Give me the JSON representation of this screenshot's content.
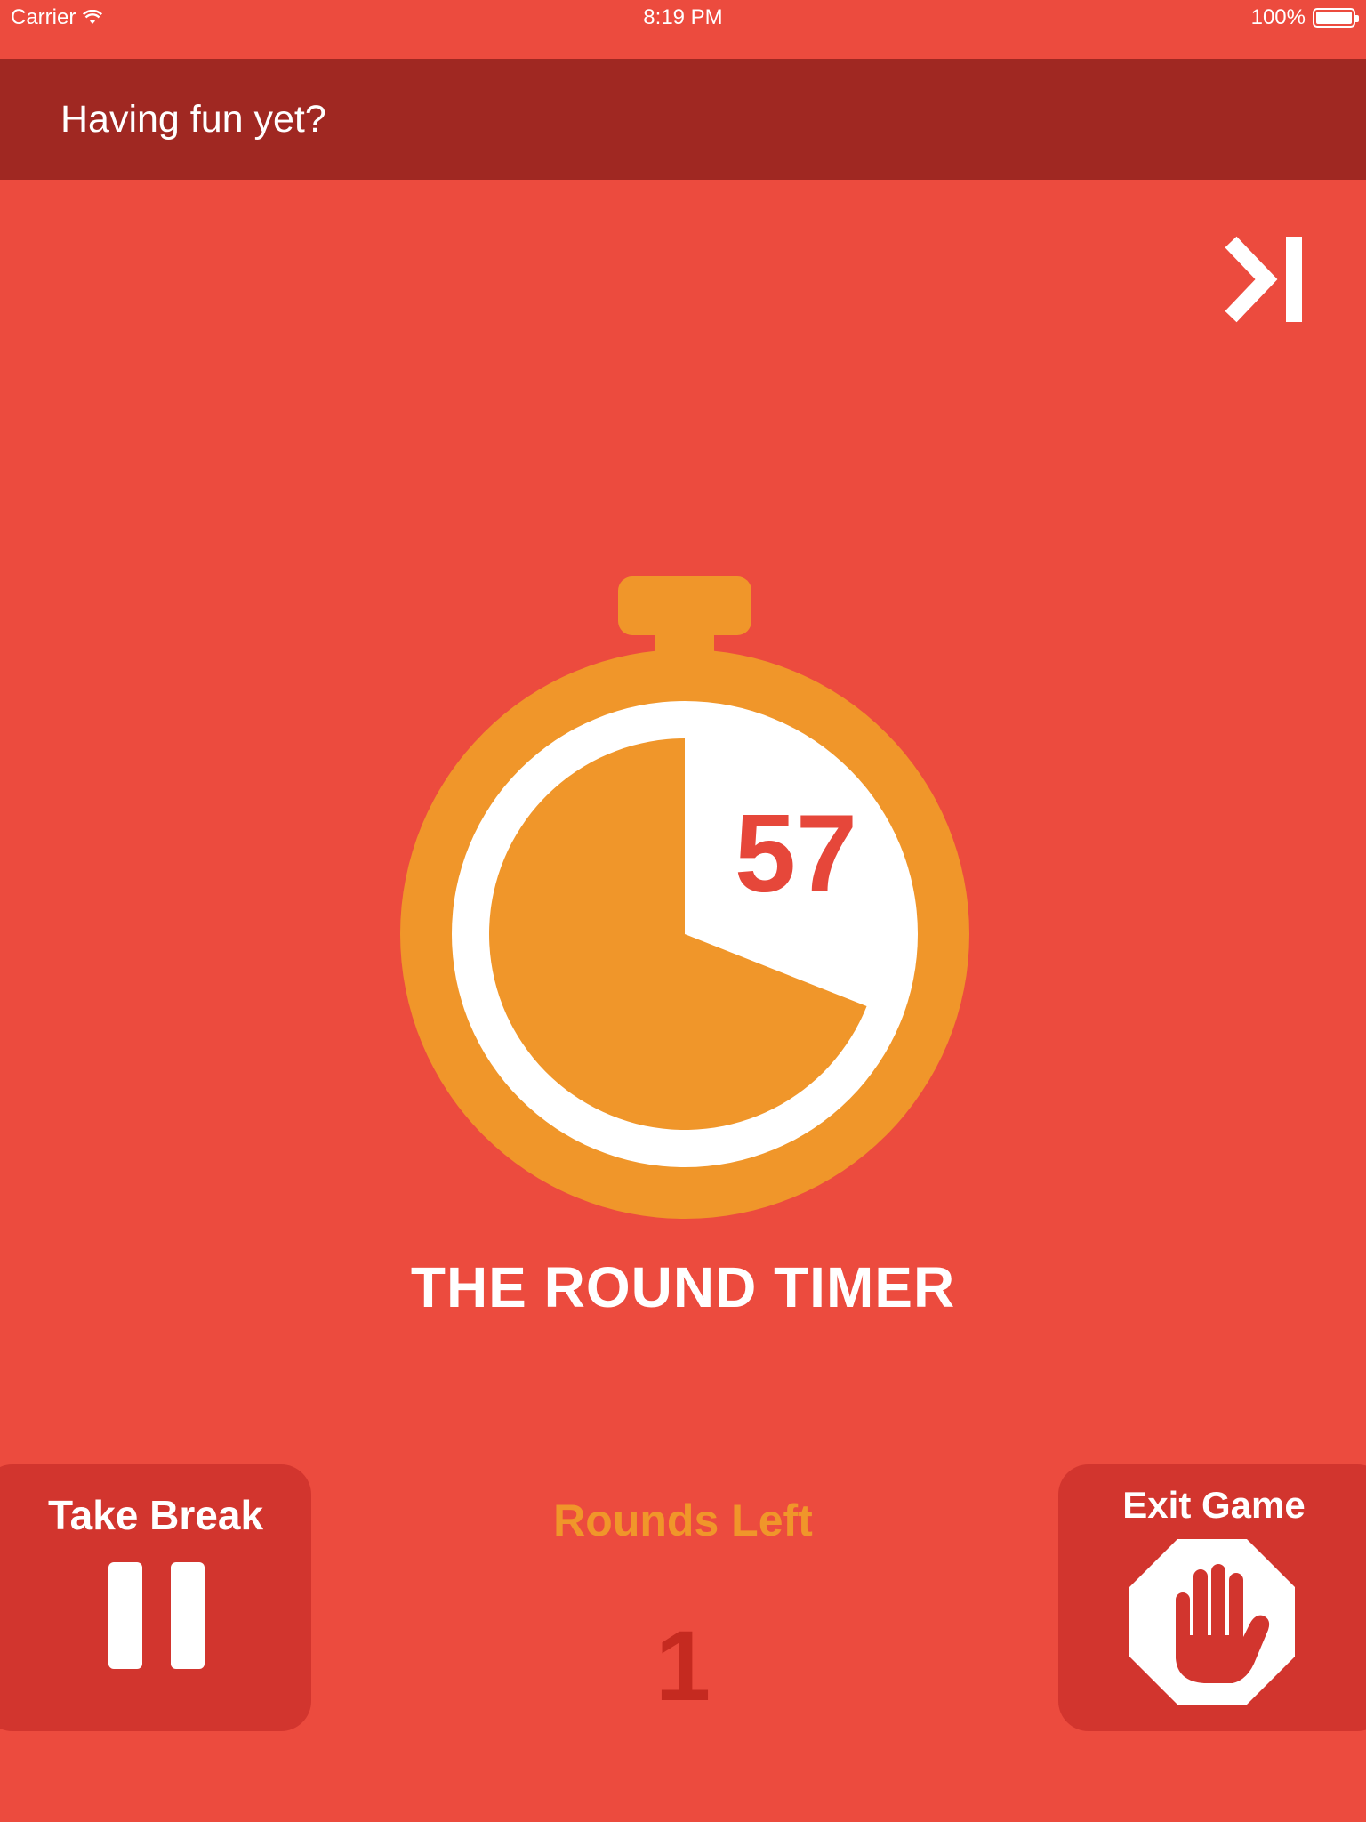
{
  "status_bar": {
    "carrier": "Carrier",
    "time": "8:19 PM",
    "battery": "100%"
  },
  "header": {
    "title": "Having fun yet?"
  },
  "timer": {
    "seconds": "57",
    "title": "THE ROUND TIMER",
    "remaining_fraction": 0.69
  },
  "take_break": {
    "label": "Take Break"
  },
  "rounds": {
    "label": "Rounds Left",
    "value": "1"
  },
  "exit_game": {
    "label": "Exit Game"
  },
  "icons": {
    "wifi": "wifi-icon",
    "battery": "battery-icon",
    "skip": "skip-forward-icon",
    "pause": "pause-icon",
    "stop": "stop-hand-icon"
  },
  "colors": {
    "background": "#EC4B3E",
    "header": "#A02822",
    "accent_orange": "#F0962A",
    "panel": "#D2352E",
    "rounds_value": "#C52A20"
  }
}
